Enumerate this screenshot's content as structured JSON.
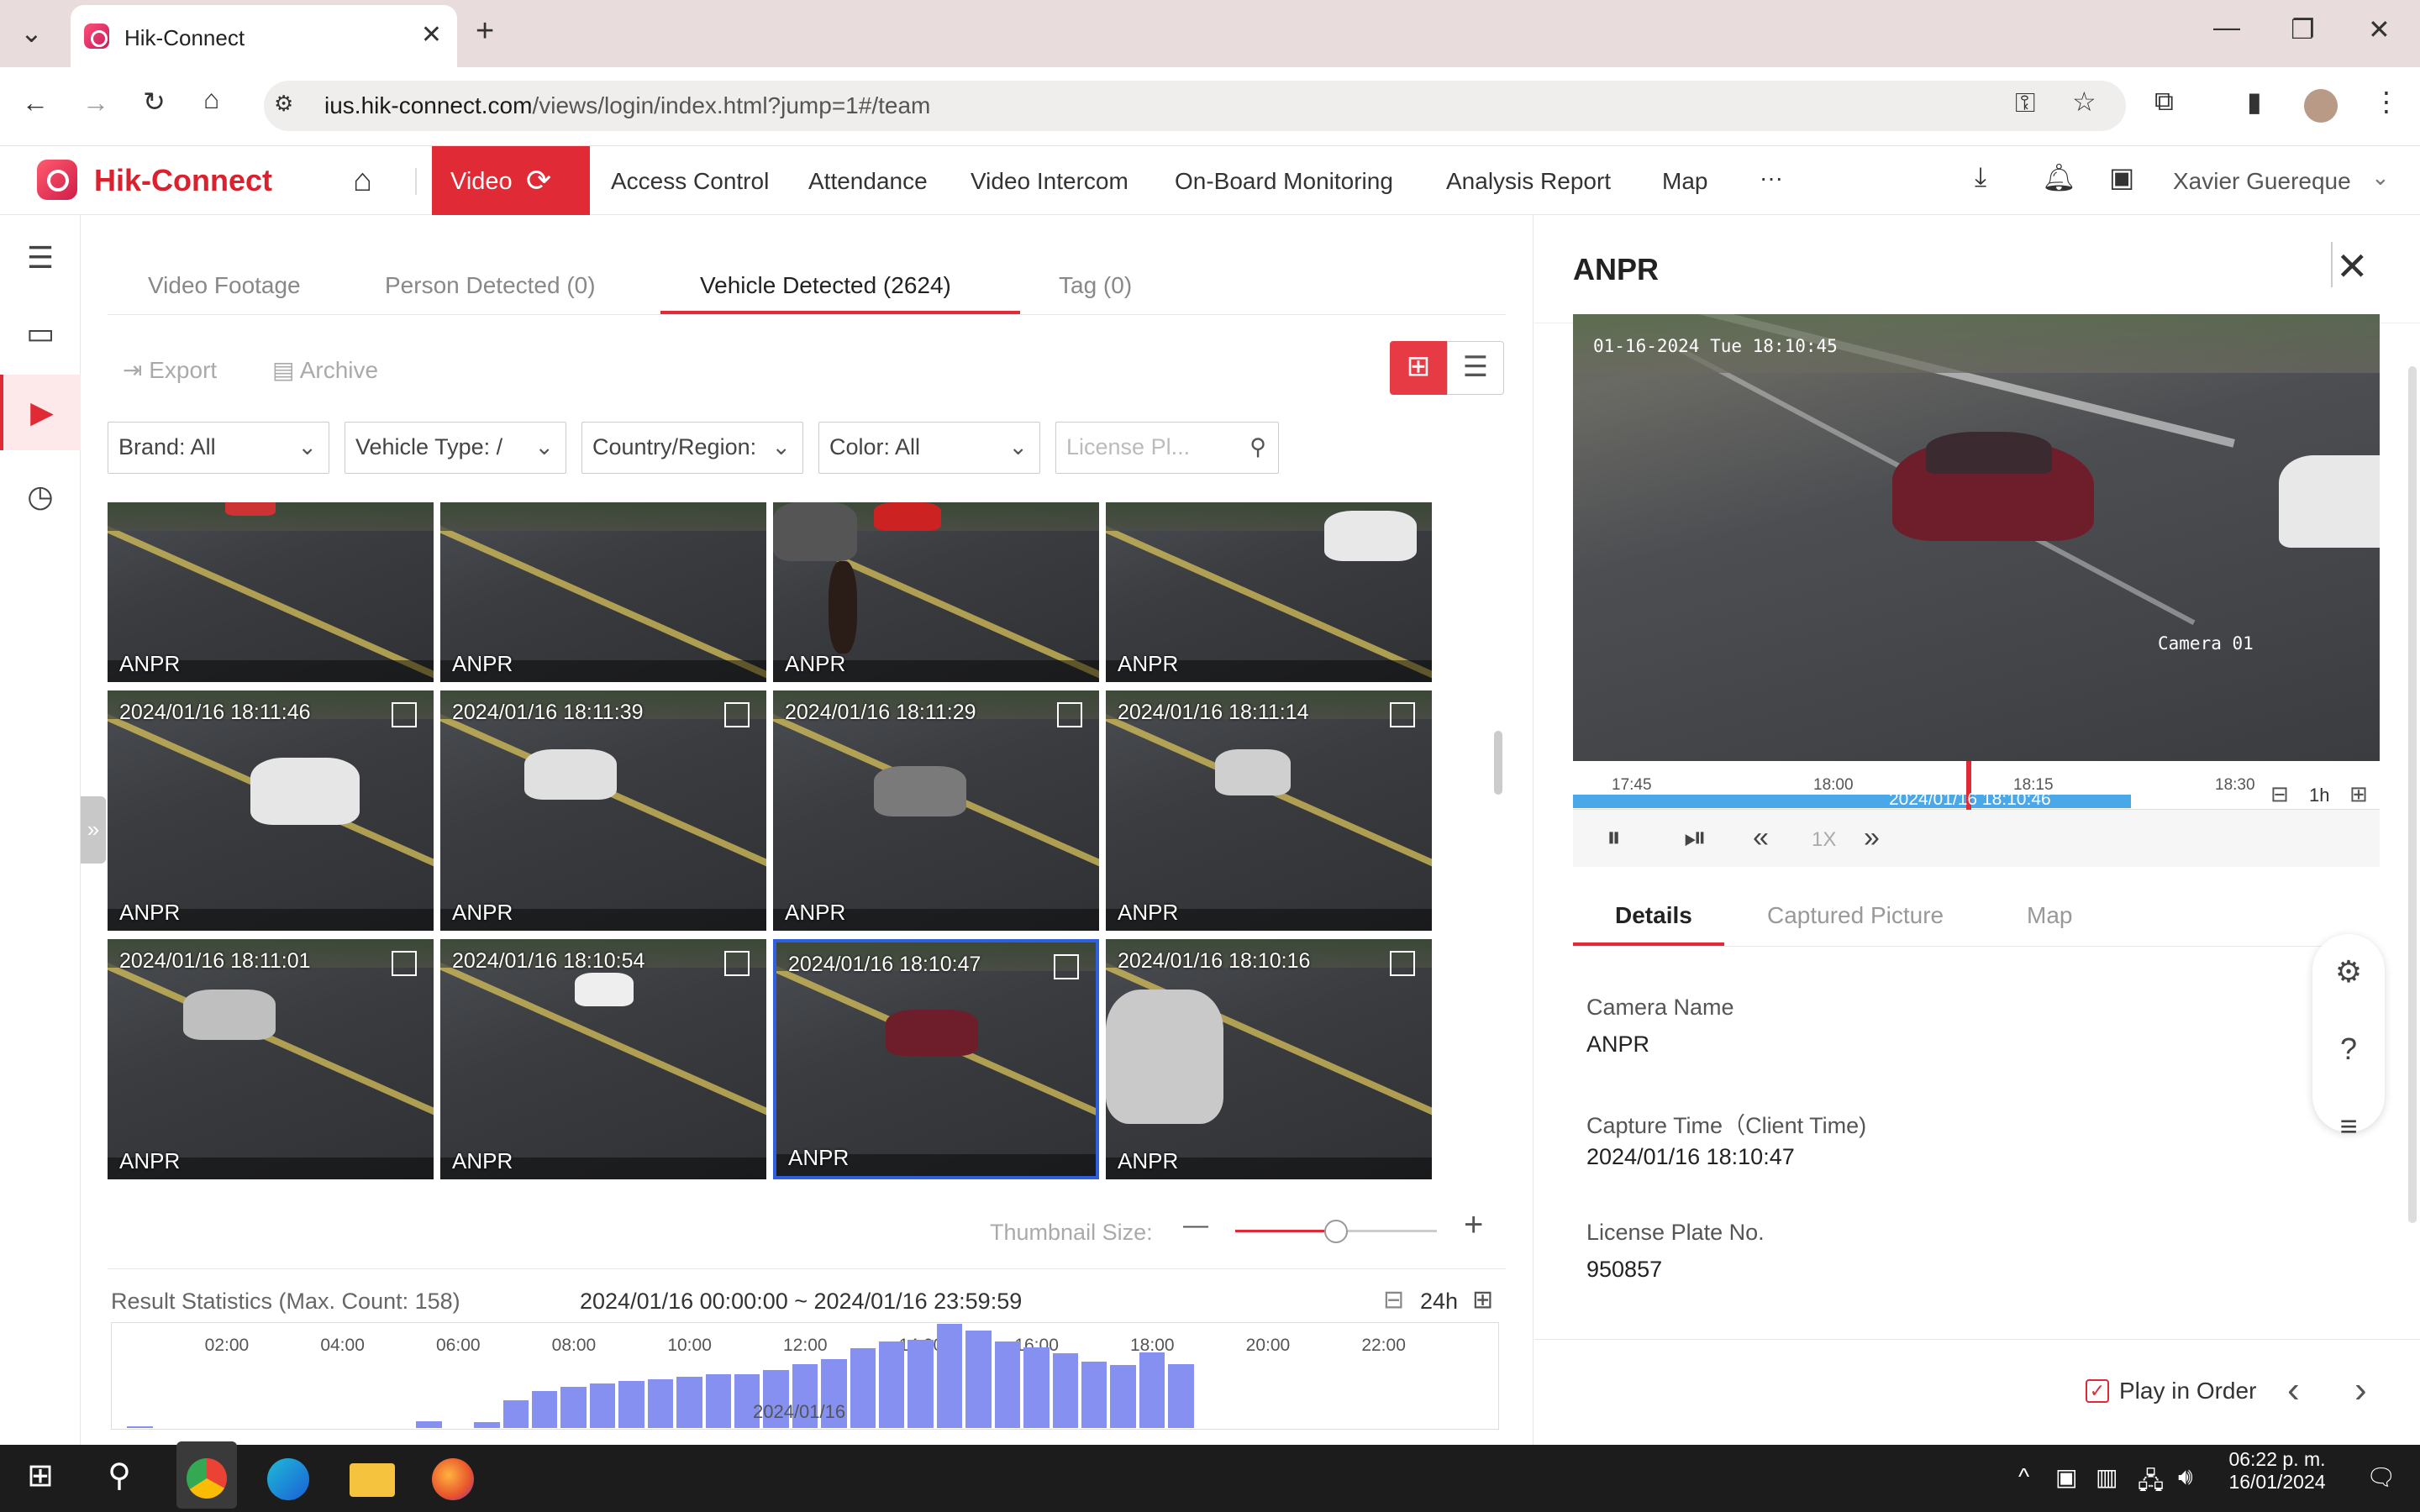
{
  "browser": {
    "tab_title": "Hik-Connect",
    "url_host": "ius.hik-connect.com",
    "url_path": "/views/login/index.html?jump=1#/team"
  },
  "header": {
    "logo_text": "Hik-Connect",
    "nav": [
      "Access Control",
      "Attendance",
      "Video Intercom",
      "On-Board Monitoring",
      "Analysis Report",
      "Map"
    ],
    "active_nav": "Video",
    "more": "···",
    "user": "Xavier Guereque",
    "accent": "#e02a35"
  },
  "tabs": {
    "video_footage": "Video Footage",
    "person_detected": "Person Detected  (0)",
    "vehicle_detected": "Vehicle Detected  (2624)",
    "tag": "Tag  (0)"
  },
  "toolbar": {
    "export": "Export",
    "archive": "Archive"
  },
  "filters": {
    "brand": "Brand:   All",
    "vehicle_type": "Vehicle Type:  /",
    "country": "Country/Region:",
    "color": "Color:   All",
    "license_placeholder": "License Pl..."
  },
  "thumbnails": {
    "row0_label": "ANPR",
    "rows": [
      [
        {
          "time": "2024/01/16 18:11:46",
          "label": "ANPR"
        },
        {
          "time": "2024/01/16 18:11:39",
          "label": "ANPR"
        },
        {
          "time": "2024/01/16 18:11:29",
          "label": "ANPR"
        },
        {
          "time": "2024/01/16 18:11:14",
          "label": "ANPR"
        }
      ],
      [
        {
          "time": "2024/01/16 18:11:01",
          "label": "ANPR"
        },
        {
          "time": "2024/01/16 18:10:54",
          "label": "ANPR"
        },
        {
          "time": "2024/01/16 18:10:47",
          "label": "ANPR"
        },
        {
          "time": "2024/01/16 18:10:16",
          "label": "ANPR"
        }
      ]
    ]
  },
  "thumbnail_size": {
    "label": "Thumbnail Size:",
    "value": 0.5
  },
  "statistics": {
    "title": "Result Statistics (Max. Count: 158)",
    "range": "2024/01/16 00:00:00 ~ 2024/01/16 23:59:59",
    "scale": "24h",
    "date": "2024/01/16"
  },
  "chart_data": {
    "type": "bar",
    "title": "Result Statistics (Max. Count: 158)",
    "x_ticks": [
      "02:00",
      "04:00",
      "06:00",
      "08:00",
      "10:00",
      "12:00",
      "14:00",
      "16:00",
      "18:00",
      "20:00",
      "22:00"
    ],
    "bins": [
      {
        "hour": 0.5,
        "value": 3
      },
      {
        "hour": 5.5,
        "value": 10
      },
      {
        "hour": 6.5,
        "value": 9
      },
      {
        "hour": 7.0,
        "value": 42
      },
      {
        "hour": 7.5,
        "value": 56
      },
      {
        "hour": 8.0,
        "value": 63
      },
      {
        "hour": 8.5,
        "value": 67
      },
      {
        "hour": 9.0,
        "value": 71
      },
      {
        "hour": 9.5,
        "value": 74
      },
      {
        "hour": 10.0,
        "value": 78
      },
      {
        "hour": 10.5,
        "value": 81
      },
      {
        "hour": 11.0,
        "value": 82
      },
      {
        "hour": 11.5,
        "value": 88
      },
      {
        "hour": 12.0,
        "value": 97
      },
      {
        "hour": 12.5,
        "value": 104
      },
      {
        "hour": 13.0,
        "value": 121
      },
      {
        "hour": 13.5,
        "value": 131
      },
      {
        "hour": 14.0,
        "value": 134
      },
      {
        "hour": 14.5,
        "value": 158
      },
      {
        "hour": 15.0,
        "value": 148
      },
      {
        "hour": 15.5,
        "value": 131
      },
      {
        "hour": 16.0,
        "value": 122
      },
      {
        "hour": 16.5,
        "value": 113
      },
      {
        "hour": 17.0,
        "value": 101
      },
      {
        "hour": 17.5,
        "value": 96
      },
      {
        "hour": 18.0,
        "value": 115
      },
      {
        "hour": 18.5,
        "value": 97
      }
    ],
    "xlim": [
      0,
      24
    ],
    "ylim": [
      0,
      158
    ]
  },
  "panel": {
    "title": "ANPR",
    "video_timestamp": "01-16-2024 Tue 18:10:45",
    "camera_overlay": "Camera 01",
    "timeline_ticks": [
      "17:45",
      "18:00",
      "18:15",
      "18:30"
    ],
    "timeline_current": "2024/01/16 18:10:46",
    "timeline_scale": "1h",
    "speed": "1X",
    "tabs": [
      "Details",
      "Captured Picture",
      "Map"
    ],
    "details": {
      "camera_name_label": "Camera Name",
      "camera_name": "ANPR",
      "capture_time_label": "Capture Time（Client Time)",
      "capture_time": "2024/01/16 18:10:47",
      "plate_label": "License Plate No.",
      "plate": "950857"
    },
    "play_in_order": "Play in Order"
  },
  "taskbar": {
    "time": "06:22 p. m.",
    "date": "16/01/2024"
  }
}
